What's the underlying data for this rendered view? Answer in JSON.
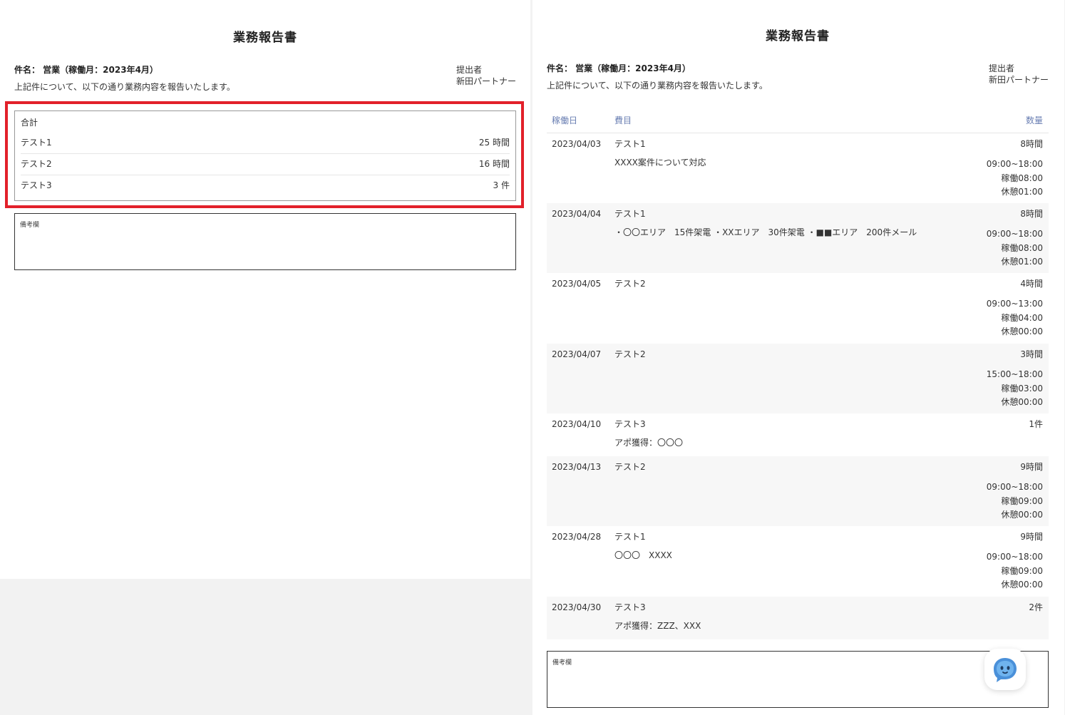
{
  "left": {
    "title": "業務報告書",
    "subject": "件名： 営業（稼働月：2023年4月）",
    "intro": "上記件について、以下の通り業務内容を報告いたします。",
    "submitter_label": "提出者",
    "submitter_name": "新田パートナー",
    "totals": {
      "title": "合計",
      "rows": [
        {
          "name": "テスト1",
          "value": "25 時間"
        },
        {
          "name": "テスト2",
          "value": "16 時間"
        },
        {
          "name": "テスト3",
          "value": "3 件"
        }
      ]
    },
    "remarks_label": "備考欄"
  },
  "right": {
    "title": "業務報告書",
    "subject": "件名： 営業（稼働月：2023年4月）",
    "intro": "上記件について、以下の通り業務内容を報告いたします。",
    "submitter_label": "提出者",
    "submitter_name": "新田パートナー",
    "headers": {
      "date": "稼働日",
      "item": "費目",
      "qty": "数量"
    },
    "rows": [
      {
        "date": "2023/04/03",
        "item": "テスト1",
        "desc": "XXXX案件について対応",
        "qty": "8時間",
        "time": "09:00~18:00",
        "work": "稼働08:00",
        "rest": "休憩01:00"
      },
      {
        "date": "2023/04/04",
        "item": "テスト1",
        "desc": "・〇〇エリア　15件架電 ・XXエリア　30件架電 ・■■エリア　200件メール",
        "qty": "8時間",
        "time": "09:00~18:00",
        "work": "稼働08:00",
        "rest": "休憩01:00"
      },
      {
        "date": "2023/04/05",
        "item": "テスト2",
        "desc": "",
        "qty": "4時間",
        "time": "09:00~13:00",
        "work": "稼働04:00",
        "rest": "休憩00:00"
      },
      {
        "date": "2023/04/07",
        "item": "テスト2",
        "desc": "",
        "qty": "3時間",
        "time": "15:00~18:00",
        "work": "稼働03:00",
        "rest": "休憩00:00"
      },
      {
        "date": "2023/04/10",
        "item": "テスト3",
        "desc": "アポ獲得：〇〇〇",
        "qty": "1件",
        "time": "",
        "work": "",
        "rest": ""
      },
      {
        "date": "2023/04/13",
        "item": "テスト2",
        "desc": "",
        "qty": "9時間",
        "time": "09:00~18:00",
        "work": "稼働09:00",
        "rest": "休憩00:00"
      },
      {
        "date": "2023/04/28",
        "item": "テスト1",
        "desc": "〇〇〇　XXXX",
        "qty": "9時間",
        "time": "09:00~18:00",
        "work": "稼働09:00",
        "rest": "休憩00:00"
      },
      {
        "date": "2023/04/30",
        "item": "テスト3",
        "desc": "アポ獲得：ZZZ、XXX",
        "qty": "2件",
        "time": "",
        "work": "",
        "rest": ""
      }
    ],
    "remarks_label": "備考欄"
  },
  "colors": {
    "highlight": "#e2202a",
    "header_text": "#6a7fb3",
    "alt_row": "#f7f7f7",
    "chat_icon": "#4a90d9"
  },
  "icons": {
    "chat": "chat-bot-icon"
  }
}
